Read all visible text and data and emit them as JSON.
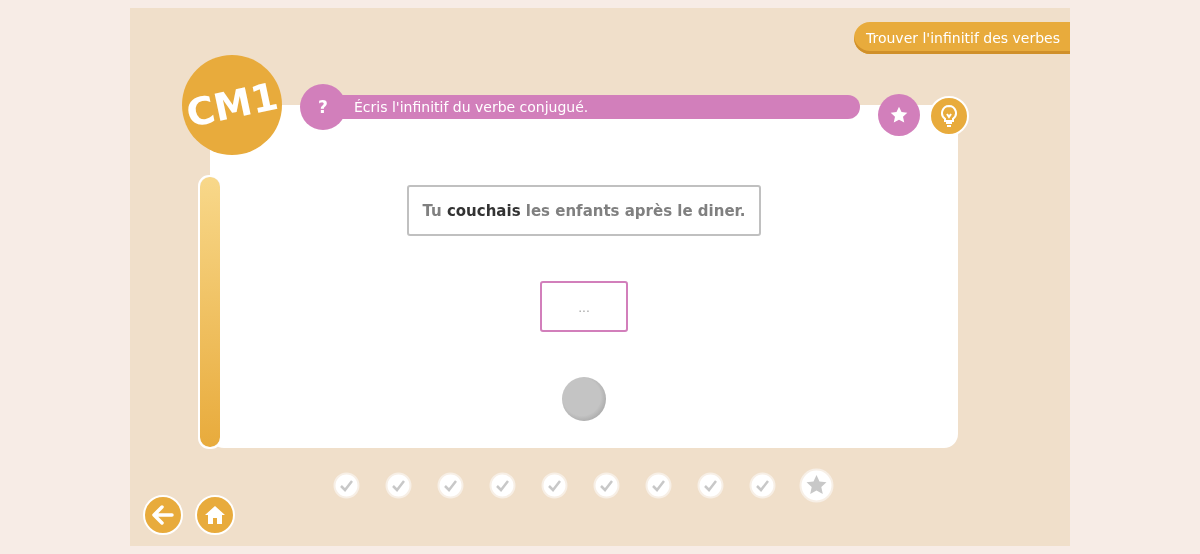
{
  "header": {
    "title_button": "Trouver l'infinitif des verbes"
  },
  "level_badge": "CM1",
  "progress_bar": {
    "level": 1
  },
  "instruction": {
    "icon": "?",
    "text": "Écris l'infinitif du verbe conjugué."
  },
  "sentence": "Tu **couchais** les enfants après le diner.",
  "answer": {
    "placeholder": "..."
  },
  "progress": [
    {
      "kind": "check"
    },
    {
      "kind": "check"
    },
    {
      "kind": "check"
    },
    {
      "kind": "check"
    },
    {
      "kind": "check"
    },
    {
      "kind": "check"
    },
    {
      "kind": "check"
    },
    {
      "kind": "check"
    },
    {
      "kind": "check"
    },
    {
      "kind": "star"
    }
  ]
}
